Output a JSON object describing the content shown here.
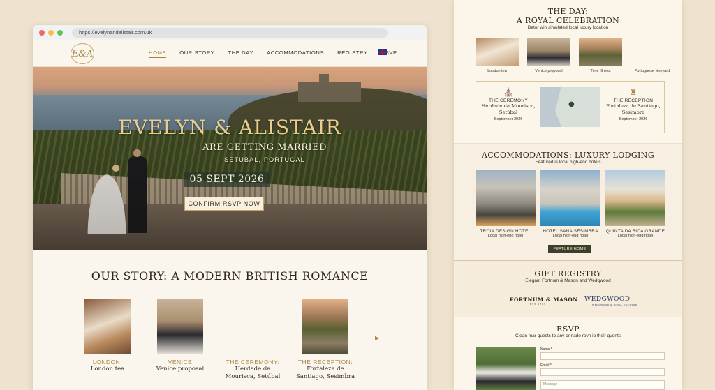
{
  "browser": {
    "url": "https://evelynandalistair.com.uk"
  },
  "nav": {
    "logo": "E&A",
    "items": [
      "HOME",
      "OUR STORY",
      "THE DAY",
      "ACCOMMODATIONS",
      "REGISTRY",
      "RSVP"
    ],
    "active_item": "HOME",
    "flag_icon": "uk-flag-icon"
  },
  "hero": {
    "title": "EVELYN & ALISTAIR",
    "subtitle": "ARE GETTING MARRIED",
    "location": "SETUBAL, PORTUGAL",
    "date": "05 SEPT 2026",
    "button": "CONFIRM RSVP NOW"
  },
  "story": {
    "heading": "OUR STORY: A MODERN BRITISH ROMANCE",
    "items": [
      {
        "title": "LONDON:",
        "text": "London tea"
      },
      {
        "title": "VENICE",
        "text": "Venice proposal"
      },
      {
        "title": "THE CEREMONY:",
        "text": "Herdade da Mourisca, Setúbal"
      },
      {
        "title": "THE RECEPTION:",
        "text": "Fortaleza de Santiago, Sesimbra"
      }
    ]
  },
  "the_day": {
    "heading_line1": "THE DAY:",
    "heading_line2": "A ROYAL CELEBRATION",
    "subtitle": "Detor win simulated local luxury location",
    "photos": [
      "London tea",
      "Venice proposal",
      "Time Illness",
      "Portuguese vineyard"
    ],
    "ceremony": {
      "label": "THE CEREMONY",
      "name": "Herdade da Mourisca, Setúbal",
      "date": "September 2026"
    },
    "reception": {
      "label": "THE RECEPTION",
      "name": "Fortaleza de Santiago, Sesimbra",
      "date": "September 2026"
    }
  },
  "accommodations": {
    "heading": "ACCOMMODATIONS: LUXURY LODGING",
    "subtitle": "Featured is local high-end hotels",
    "hotels": [
      {
        "name": "TROIA DESIGN HOTEL",
        "desc": "Local high-end hotel"
      },
      {
        "name": "HOTEL SANA SESIMBRA",
        "desc": "Local high-end hotel"
      },
      {
        "name": "QUINTA DA BICA GRANDE",
        "desc": "Local high-end hotel"
      }
    ],
    "button": "FEATURE HOME"
  },
  "registry": {
    "heading": "GIFT REGISTRY",
    "subtitle": "Elegant Fortnum & Mason and Wedgwood",
    "brand1": "FORTNUM & MASON",
    "brand1_sub": "EST 1707",
    "brand2": "WEDGWOOD",
    "brand2_sub": "WEDGWOOD & ROYAL DOULTON"
  },
  "rsvp": {
    "heading": "RSVP",
    "subtitle": "Clean mar guests to any onnado rovn io their quents",
    "name_label": "Name *",
    "email_label": "Email *",
    "message_placeholder": "Message"
  }
}
